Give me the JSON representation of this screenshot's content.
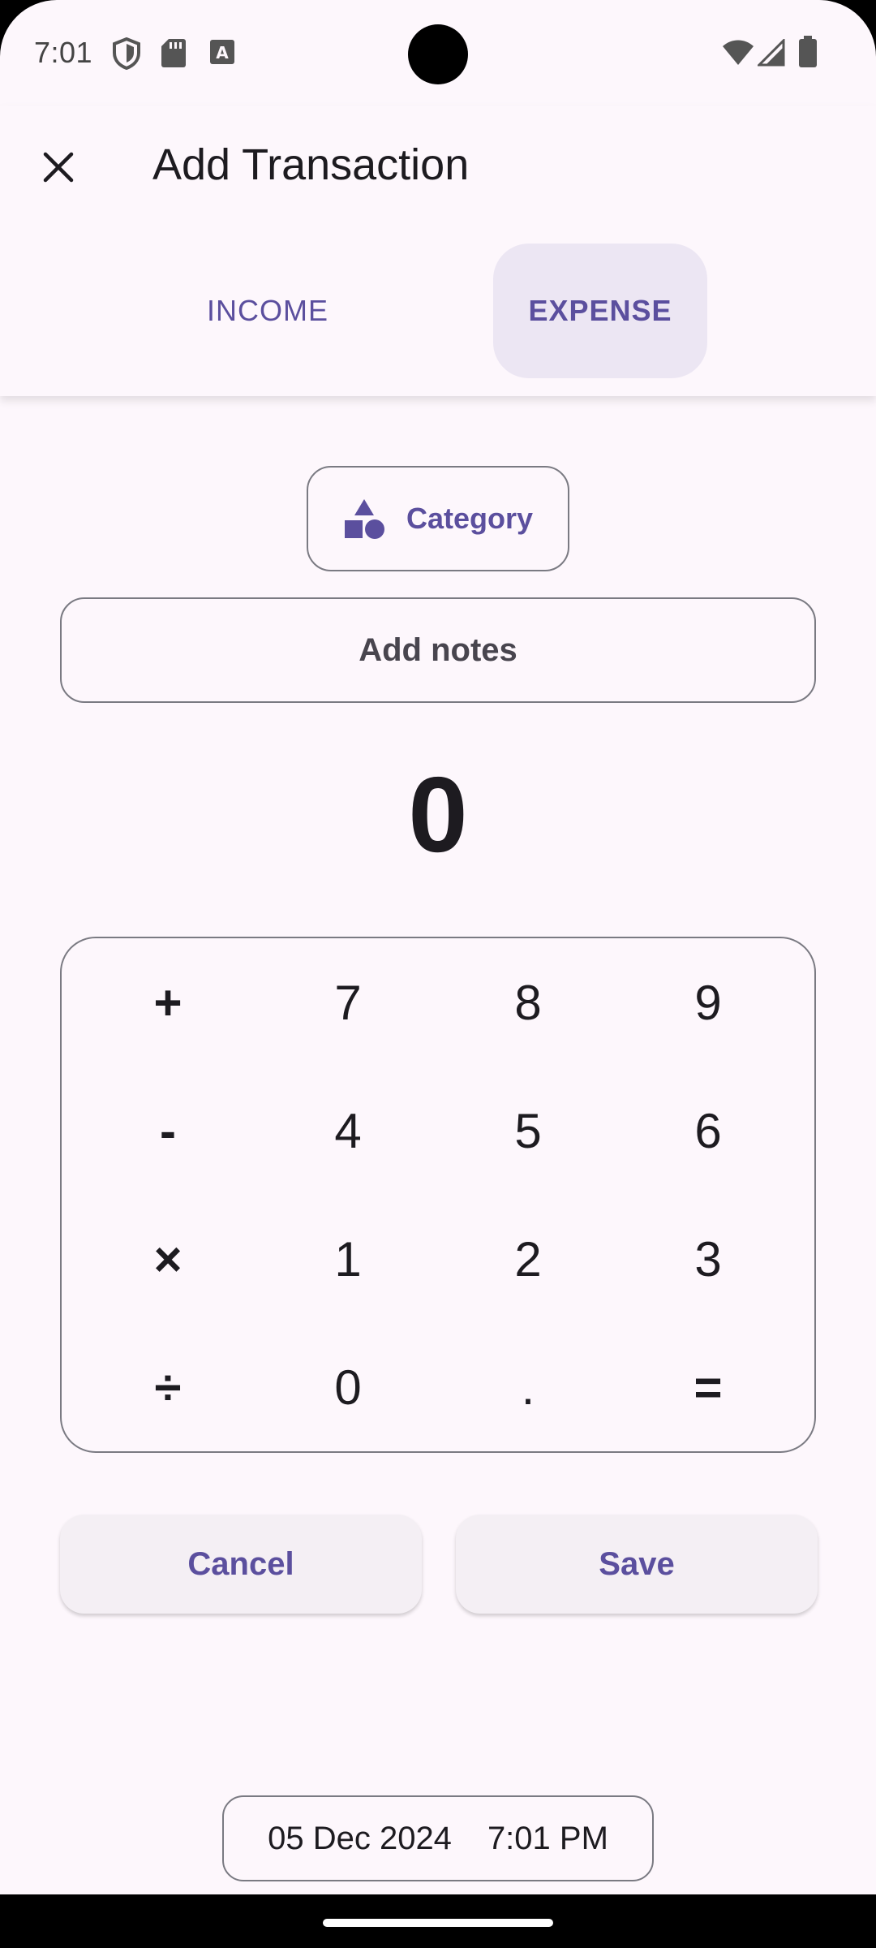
{
  "status_bar": {
    "time": "7:01",
    "left_icons": [
      "shield-icon",
      "sd-card-icon",
      "keyboard-a-icon"
    ],
    "right_icons": [
      "wifi-icon",
      "cell-signal-icon",
      "battery-icon"
    ]
  },
  "app_bar": {
    "title": "Add Transaction",
    "close_icon": "close-icon"
  },
  "tabs": [
    {
      "label": "INCOME",
      "selected": false
    },
    {
      "label": "EXPENSE",
      "selected": true
    }
  ],
  "category": {
    "label": "Category",
    "icon": "shapes-icon"
  },
  "notes": {
    "label": "Add notes"
  },
  "amount": "0",
  "keypad": {
    "keys": [
      "+",
      "7",
      "8",
      "9",
      "-",
      "4",
      "5",
      "6",
      "×",
      "1",
      "2",
      "3",
      "÷",
      "0",
      ".",
      "="
    ]
  },
  "actions": {
    "cancel": "Cancel",
    "save": "Save"
  },
  "datetime": {
    "date": "05 Dec 2024",
    "time": "7:01 PM"
  },
  "colors": {
    "accent": "#5b4f9e",
    "background": "#fdf7fc",
    "tab_selected_bg": "#ece6f3",
    "button_bg": "#f4eff4"
  }
}
